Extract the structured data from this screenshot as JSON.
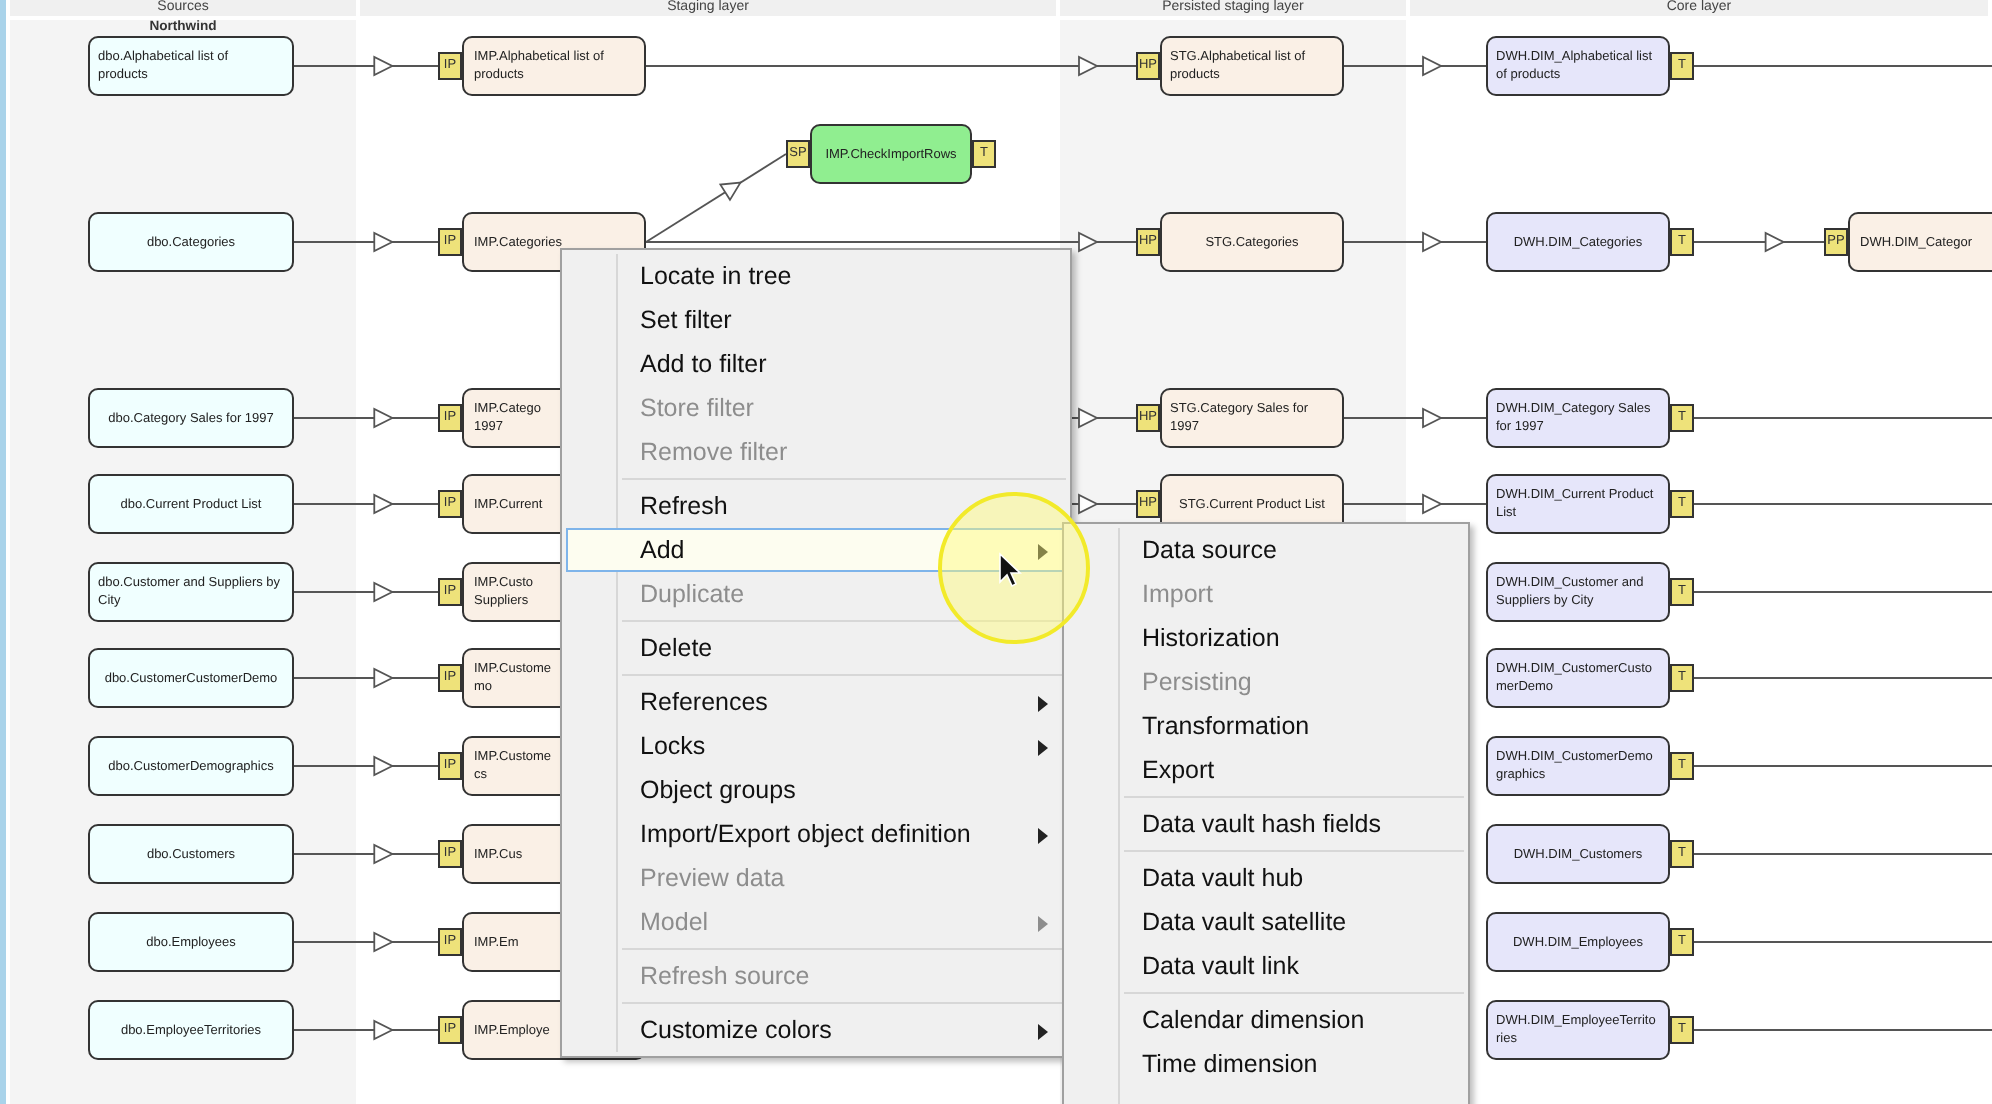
{
  "lanes": [
    {
      "title": "Sources",
      "subtitle": "Northwind"
    },
    {
      "title": "Staging layer"
    },
    {
      "title": "Persisted staging layer"
    },
    {
      "title": "Core layer"
    }
  ],
  "rows": [
    {
      "source": {
        "kind": "source",
        "lines": [
          "dbo.Alphabetical list of",
          "products"
        ]
      },
      "staging": {
        "kind": "staging",
        "tag": "IP",
        "lines": [
          "IMP.Alphabetical list of",
          "products"
        ]
      },
      "persisted": {
        "kind": "staging",
        "tag": "HP",
        "lines": [
          "STG.Alphabetical list of",
          "products"
        ]
      },
      "core": {
        "kind": "core",
        "tag": "T",
        "lines": [
          "DWH.DIM_Alphabetical list",
          "of products"
        ]
      }
    },
    {
      "source": {
        "kind": "source",
        "lines": [
          "dbo.Categories"
        ]
      },
      "staging": {
        "kind": "staging",
        "tag": "IP",
        "lines": [
          "IMP.Categories"
        ]
      },
      "branch": {
        "kind": "procedure",
        "tag": "SP",
        "tag_right": "T",
        "lines": [
          "IMP.CheckImportRows"
        ]
      },
      "persisted": {
        "kind": "staging",
        "tag": "HP",
        "lines": [
          "STG.Categories"
        ]
      },
      "core": {
        "kind": "core",
        "tag": "T",
        "lines": [
          "DWH.DIM_Categories"
        ]
      },
      "next": {
        "kind": "staging",
        "tag": "PP",
        "lines": [
          "DWH.DIM_Categor"
        ]
      }
    },
    {
      "source": {
        "kind": "source",
        "lines": [
          "dbo.Category Sales for 1997"
        ]
      },
      "staging": {
        "kind": "staging",
        "tag": "IP",
        "lines": [
          "IMP.Catego",
          "1997"
        ]
      },
      "persisted": {
        "kind": "staging",
        "tag": "HP",
        "lines": [
          "STG.Category Sales for",
          "1997"
        ]
      },
      "core": {
        "kind": "core",
        "tag": "T",
        "lines": [
          "DWH.DIM_Category Sales",
          "for 1997"
        ]
      }
    },
    {
      "source": {
        "kind": "source",
        "lines": [
          "dbo.Current Product List"
        ]
      },
      "staging": {
        "kind": "staging",
        "tag": "IP",
        "lines": [
          "IMP.Current"
        ]
      },
      "persisted": {
        "kind": "staging",
        "tag": "HP",
        "lines": [
          "STG.Current Product List"
        ]
      },
      "core": {
        "kind": "core",
        "tag": "T",
        "lines": [
          "DWH.DIM_Current Product",
          "List"
        ]
      }
    },
    {
      "source": {
        "kind": "source",
        "lines": [
          "dbo.Customer and Suppliers by",
          "City"
        ]
      },
      "staging": {
        "kind": "staging",
        "tag": "IP",
        "lines": [
          "IMP.Custo",
          "Suppliers"
        ]
      },
      "core": {
        "kind": "core",
        "tag": "T",
        "lines": [
          "DWH.DIM_Customer and",
          "Suppliers by City"
        ]
      }
    },
    {
      "source": {
        "kind": "source",
        "lines": [
          "dbo.CustomerCustomerDemo"
        ]
      },
      "staging": {
        "kind": "staging",
        "tag": "IP",
        "lines": [
          "IMP.Custome",
          "mo"
        ]
      },
      "core": {
        "kind": "core",
        "tag": "T",
        "lines": [
          "DWH.DIM_CustomerCusto",
          "merDemo"
        ]
      }
    },
    {
      "source": {
        "kind": "source",
        "lines": [
          "dbo.CustomerDemographics"
        ]
      },
      "staging": {
        "kind": "staging",
        "tag": "IP",
        "lines": [
          "IMP.Custome",
          "cs"
        ]
      },
      "core": {
        "kind": "core",
        "tag": "T",
        "lines": [
          "DWH.DIM_CustomerDemo",
          "graphics"
        ]
      }
    },
    {
      "source": {
        "kind": "source",
        "lines": [
          "dbo.Customers"
        ]
      },
      "staging": {
        "kind": "staging",
        "tag": "IP",
        "lines": [
          "IMP.Cus"
        ]
      },
      "core": {
        "kind": "core",
        "tag": "T",
        "lines": [
          "DWH.DIM_Customers"
        ]
      }
    },
    {
      "source": {
        "kind": "source",
        "lines": [
          "dbo.Employees"
        ]
      },
      "staging": {
        "kind": "staging",
        "tag": "IP",
        "lines": [
          "IMP.Em"
        ]
      },
      "core": {
        "kind": "core",
        "tag": "T",
        "lines": [
          "DWH.DIM_Employees"
        ]
      }
    },
    {
      "source": {
        "kind": "source",
        "lines": [
          "dbo.EmployeeTerritories"
        ]
      },
      "staging": {
        "kind": "staging",
        "tag": "IP",
        "lines": [
          "IMP.Employe"
        ]
      },
      "core": {
        "kind": "core",
        "tag": "T",
        "lines": [
          "DWH.DIM_EmployeeTerrito",
          "ries"
        ]
      }
    }
  ],
  "context_menu": {
    "groups": [
      [
        {
          "label": "Locate in tree",
          "disabled": false,
          "submenu": false,
          "selected": false
        },
        {
          "label": "Set filter",
          "disabled": false,
          "submenu": false,
          "selected": false
        },
        {
          "label": "Add to filter",
          "disabled": false,
          "submenu": false,
          "selected": false
        },
        {
          "label": "Store filter",
          "disabled": true,
          "submenu": false,
          "selected": false
        },
        {
          "label": "Remove filter",
          "disabled": true,
          "submenu": false,
          "selected": false
        }
      ],
      [
        {
          "label": "Refresh",
          "disabled": false,
          "submenu": false,
          "selected": false
        },
        {
          "label": "Add",
          "disabled": false,
          "submenu": true,
          "selected": true
        },
        {
          "label": "Duplicate",
          "disabled": true,
          "submenu": false,
          "selected": false
        }
      ],
      [
        {
          "label": "Delete",
          "disabled": false,
          "submenu": false,
          "selected": false
        }
      ],
      [
        {
          "label": "References",
          "disabled": false,
          "submenu": true,
          "selected": false
        },
        {
          "label": "Locks",
          "disabled": false,
          "submenu": true,
          "selected": false
        },
        {
          "label": "Object groups",
          "disabled": false,
          "submenu": false,
          "selected": false
        },
        {
          "label": "Import/Export object definition",
          "disabled": false,
          "submenu": true,
          "selected": false
        },
        {
          "label": "Preview data",
          "disabled": true,
          "submenu": false,
          "selected": false
        },
        {
          "label": "Model",
          "disabled": true,
          "submenu": true,
          "selected": false
        }
      ],
      [
        {
          "label": "Refresh source",
          "disabled": true,
          "submenu": false,
          "selected": false
        }
      ],
      [
        {
          "label": "Customize colors",
          "disabled": false,
          "submenu": true,
          "selected": false
        }
      ]
    ]
  },
  "submenu": {
    "groups": [
      [
        {
          "label": "Data source",
          "disabled": false
        },
        {
          "label": "Import",
          "disabled": true
        },
        {
          "label": "Historization",
          "disabled": false
        },
        {
          "label": "Persisting",
          "disabled": true
        },
        {
          "label": "Transformation",
          "disabled": false
        },
        {
          "label": "Export",
          "disabled": false
        }
      ],
      [
        {
          "label": "Data vault hash fields",
          "disabled": false
        }
      ],
      [
        {
          "label": "Data vault hub",
          "disabled": false
        },
        {
          "label": "Data vault satellite",
          "disabled": false
        },
        {
          "label": "Data vault link",
          "disabled": false
        }
      ],
      [
        {
          "label": "Calendar dimension",
          "disabled": false
        },
        {
          "label": "Time dimension",
          "disabled": false
        }
      ]
    ]
  }
}
